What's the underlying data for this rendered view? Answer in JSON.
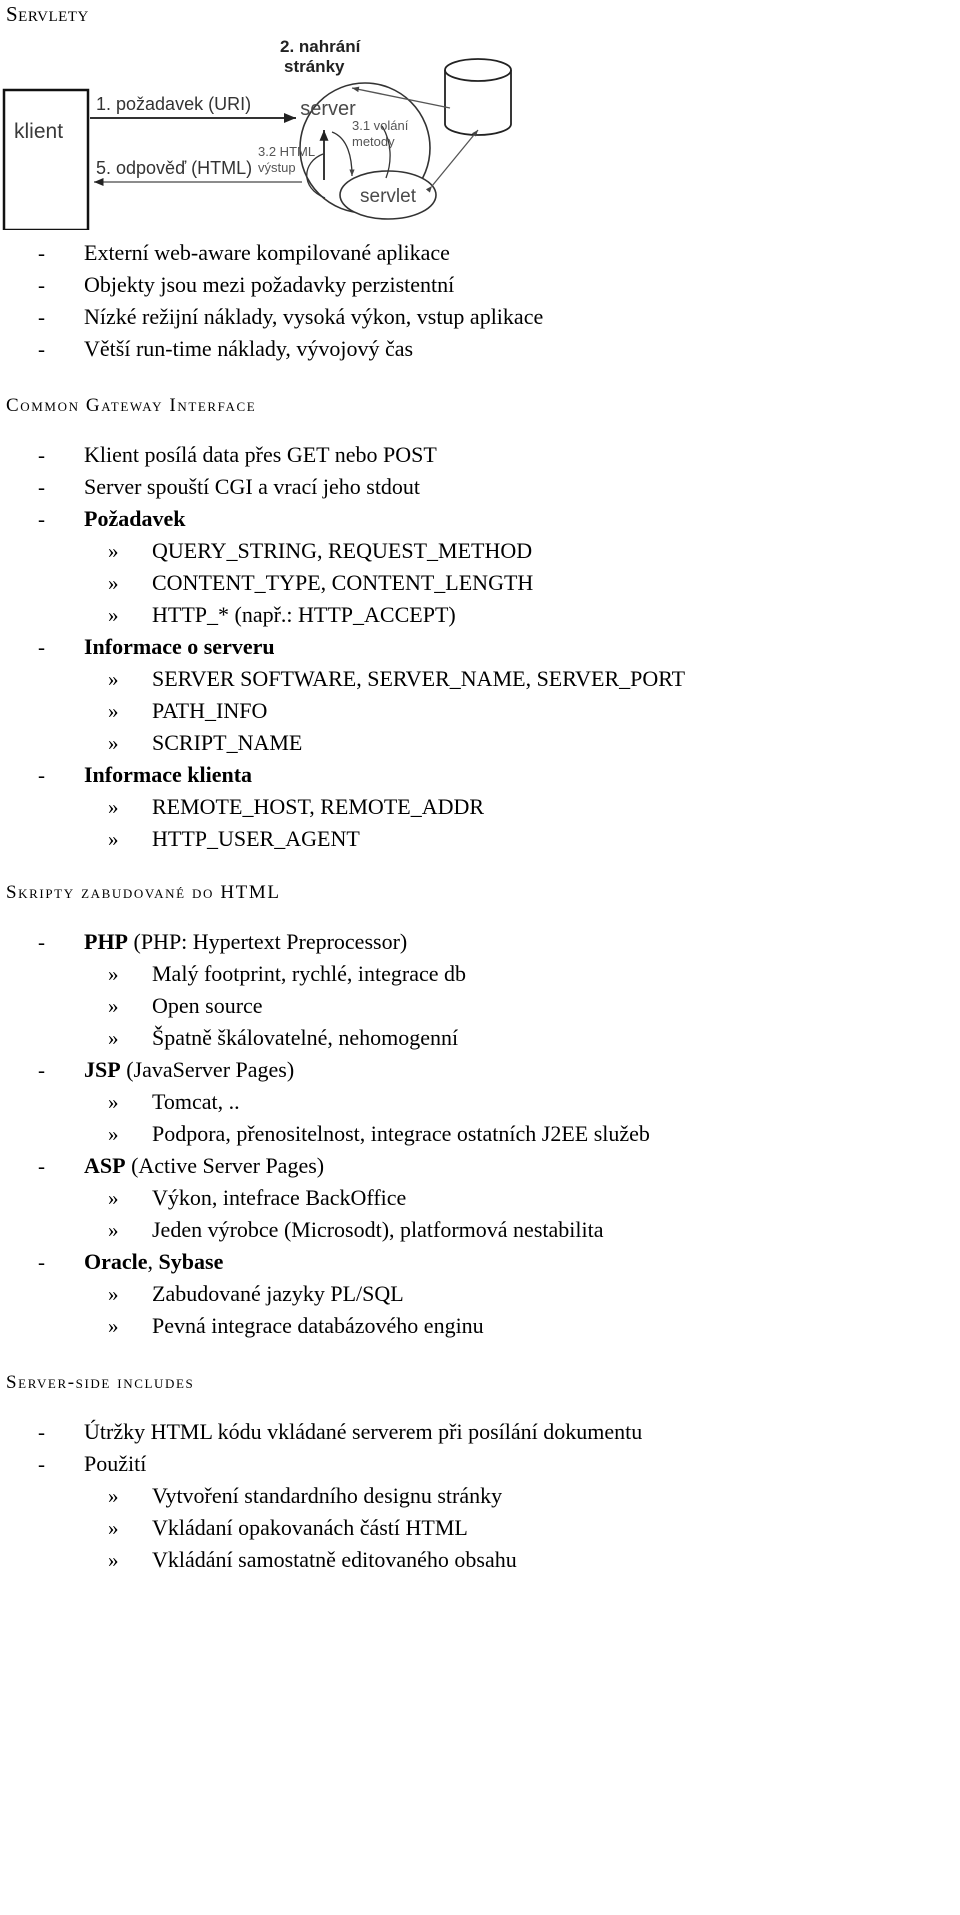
{
  "page": {
    "title": "Servlety"
  },
  "diagram": {
    "name": "servlet-request-flow-diagram",
    "client_box_label": "klient",
    "server_label": "server",
    "servlet_label": "servlet",
    "arrow_request": "1. požadavek (URI)",
    "arrow_response": "5. odpověď (HTML)",
    "arrow_load_line1": "2. nahrání",
    "arrow_load_line2": "stránky",
    "arrow_call_line1": "3.1 volání",
    "arrow_call_line2": "metody",
    "arrow_out_line1": "3.2 HTML",
    "arrow_out_line2": "výstup"
  },
  "servlets_list": [
    {
      "marker": "-",
      "level": 1,
      "text": "Externí web-aware kompilované aplikace"
    },
    {
      "marker": "-",
      "level": 1,
      "text": "Objekty jsou mezi požadavky perzistentní"
    },
    {
      "marker": "-",
      "level": 1,
      "text": "Nízké režijní náklady, vysoká výkon, vstup aplikace"
    },
    {
      "marker": "-",
      "level": 1,
      "text": "Větší run-time náklady, vývojový čas"
    }
  ],
  "sections": [
    {
      "heading": "Common Gateway Interface",
      "items": [
        {
          "marker": "-",
          "level": 1,
          "text": "Klient posílá data přes GET nebo POST",
          "bold": false
        },
        {
          "marker": "-",
          "level": 1,
          "text": "Server spouští CGI a vrací jeho stdout",
          "bold": false
        },
        {
          "marker": "-",
          "level": 1,
          "text": "Požadavek",
          "bold": true
        },
        {
          "marker": "»",
          "level": 2,
          "text": "QUERY_STRING, REQUEST_METHOD",
          "bold": false
        },
        {
          "marker": "»",
          "level": 2,
          "text": "CONTENT_TYPE, CONTENT_LENGTH",
          "bold": false
        },
        {
          "marker": "»",
          "level": 2,
          "text": "HTTP_* (např.: HTTP_ACCEPT)",
          "bold": false
        },
        {
          "marker": "-",
          "level": 1,
          "text": "Informace o serveru",
          "bold": true
        },
        {
          "marker": "»",
          "level": 2,
          "text": "SERVER SOFTWARE, SERVER_NAME, SERVER_PORT",
          "bold": false
        },
        {
          "marker": "»",
          "level": 2,
          "text": "PATH_INFO",
          "bold": false
        },
        {
          "marker": "»",
          "level": 2,
          "text": "SCRIPT_NAME",
          "bold": false
        },
        {
          "marker": "-",
          "level": 1,
          "text": "Informace klienta",
          "bold": true
        },
        {
          "marker": "»",
          "level": 2,
          "text": "REMOTE_HOST, REMOTE_ADDR",
          "bold": false
        },
        {
          "marker": "»",
          "level": 2,
          "text": "HTTP_USER_AGENT",
          "bold": false
        }
      ]
    },
    {
      "heading": "Skripty zabudované do HTML",
      "items": [
        {
          "marker": "-",
          "level": 1,
          "bold_prefix": "PHP",
          "text": " (PHP: Hypertext Preprocessor)"
        },
        {
          "marker": "»",
          "level": 2,
          "text": "Malý footprint, rychlé, integrace db"
        },
        {
          "marker": "»",
          "level": 2,
          "text": "Open source"
        },
        {
          "marker": "»",
          "level": 2,
          "text": "Špatně škálovatelné, nehomogenní"
        },
        {
          "marker": "-",
          "level": 1,
          "bold_prefix": "JSP",
          "text": " (JavaServer Pages)"
        },
        {
          "marker": "»",
          "level": 2,
          "text": "Tomcat, .."
        },
        {
          "marker": "»",
          "level": 2,
          "text": "Podpora, přenositelnost, integrace ostatních J2EE služeb"
        },
        {
          "marker": "-",
          "level": 1,
          "bold_prefix": "ASP",
          "text": " (Active Server Pages)"
        },
        {
          "marker": "»",
          "level": 2,
          "text": "Výkon, intefrace BackOffice"
        },
        {
          "marker": "»",
          "level": 2,
          "text": "Jeden výrobce (Microsodt), platformová nestabilita"
        },
        {
          "marker": "-",
          "level": 1,
          "bold_prefix": "Oracle",
          "text": ", ",
          "bold_suffix": "Sybase"
        },
        {
          "marker": "»",
          "level": 2,
          "text": "Zabudované jazyky PL/SQL"
        },
        {
          "marker": "»",
          "level": 2,
          "text": "Pevná integrace databázového enginu"
        }
      ]
    },
    {
      "heading": "Server-side includes",
      "items": [
        {
          "marker": "-",
          "level": 1,
          "text": "Útržky HTML kódu vkládané serverem při posílání dokumentu"
        },
        {
          "marker": "-",
          "level": 1,
          "text": "Použití"
        },
        {
          "marker": "»",
          "level": 2,
          "text": "Vytvoření standardního designu stránky"
        },
        {
          "marker": "»",
          "level": 2,
          "text": "Vkládaní opakovanách částí HTML"
        },
        {
          "marker": "»",
          "level": 2,
          "text": "Vkládání samostatně editovaného obsahu"
        }
      ]
    }
  ]
}
